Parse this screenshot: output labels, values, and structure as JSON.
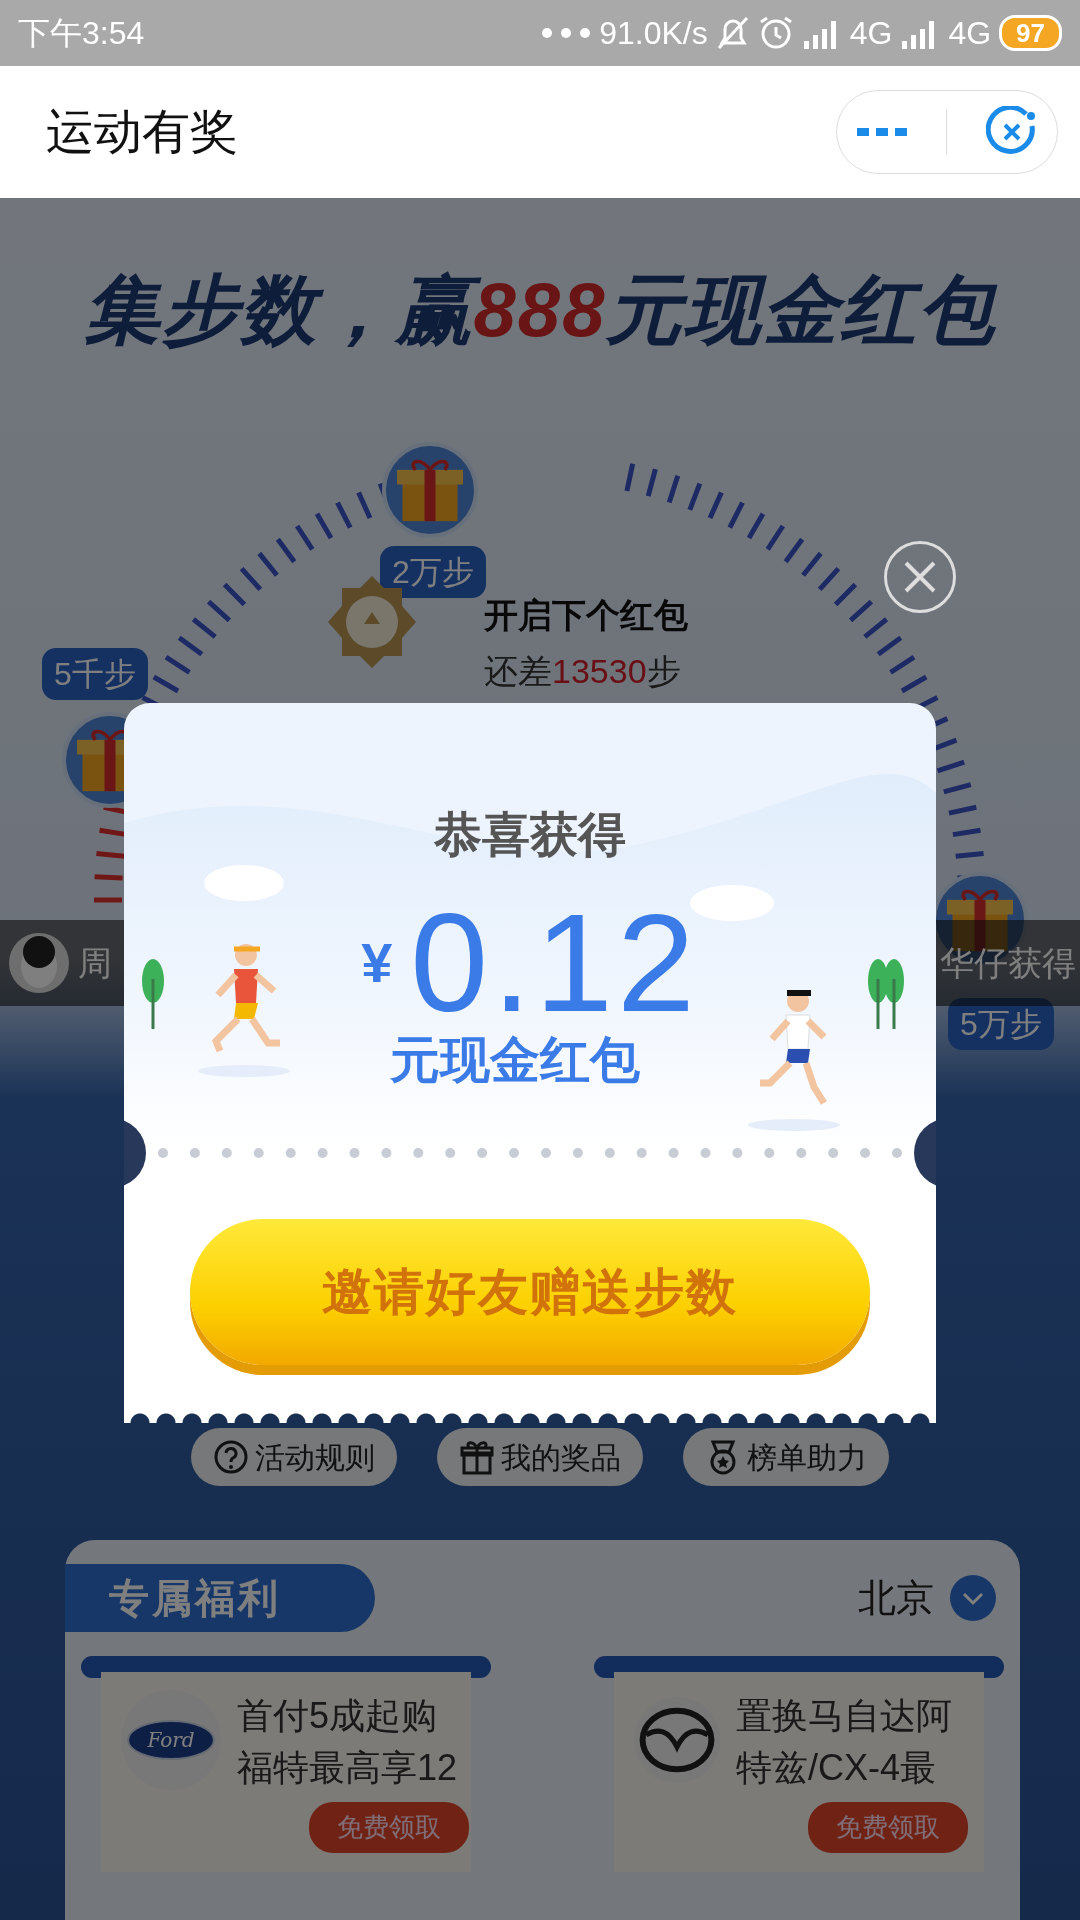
{
  "status_bar": {
    "time": "下午3:54",
    "speed": "91.0K/s",
    "networks": [
      {
        "label": "4G"
      },
      {
        "label": "4G"
      }
    ],
    "battery": "97"
  },
  "header": {
    "title": "运动有奖"
  },
  "banner": {
    "before": "集步数，赢",
    "highlight": "888",
    "after": "元现金红包"
  },
  "milestones": [
    {
      "label": "2万步"
    },
    {
      "label": "5千步"
    },
    {
      "label": "5万步"
    }
  ],
  "next_packet": {
    "title": "开启下个红包",
    "prefix": "还差",
    "remaining": "13530",
    "suffix": "步"
  },
  "ticker": [
    "周",
    "华仔获得"
  ],
  "popup": {
    "title": "恭喜获得",
    "currency": "¥",
    "amount": "0.12",
    "unit": "元现金红包",
    "button": "邀请好友赠送步数"
  },
  "actions": [
    {
      "kind": "rules",
      "label": "活动规则"
    },
    {
      "kind": "prizes",
      "label": "我的奖品"
    },
    {
      "kind": "ranking",
      "label": "榜单助力"
    }
  ],
  "benefits": {
    "title": "专属福利",
    "city": "北京",
    "offers": [
      {
        "kind": "ford",
        "logo_text": "Ford",
        "text": "首付5成起购福特最高享12",
        "button": "免费领取"
      },
      {
        "kind": "mazda",
        "text": "置换马自达阿特兹/CX-4最",
        "button": "免费领取"
      }
    ]
  }
}
